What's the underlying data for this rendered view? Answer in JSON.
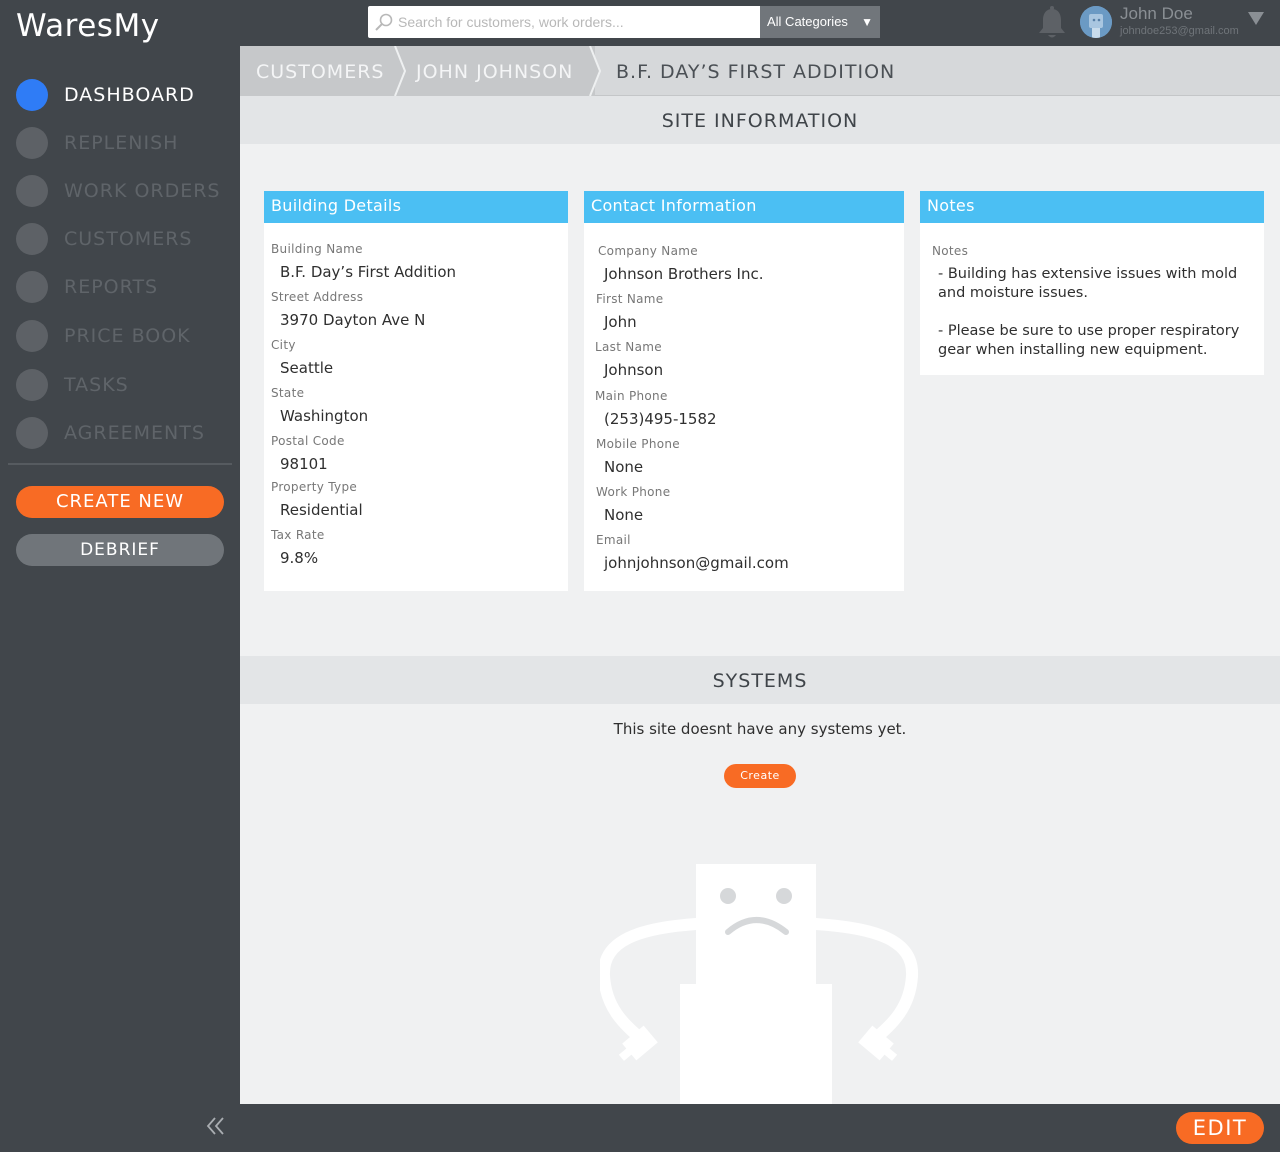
{
  "app": {
    "logo": "WaresMy"
  },
  "search": {
    "placeholder": "Search for customers, work orders...",
    "value": "",
    "category": "All Categories"
  },
  "user": {
    "name": "John Doe",
    "email": "johndoe253@gmail.com"
  },
  "sidebar": {
    "items": [
      {
        "label": "DASHBOARD",
        "active": true
      },
      {
        "label": "REPLENISH",
        "active": false
      },
      {
        "label": "WORK ORDERS",
        "active": false
      },
      {
        "label": "CUSTOMERS",
        "active": false
      },
      {
        "label": "REPORTS",
        "active": false
      },
      {
        "label": "PRICE BOOK",
        "active": false
      },
      {
        "label": "TASKS",
        "active": false
      },
      {
        "label": "AGREEMENTS",
        "active": false
      }
    ],
    "create_new": "CREATE NEW",
    "debrief": "DEBRIEF"
  },
  "breadcrumb": {
    "items": [
      "CUSTOMERS",
      "JOHN JOHNSON",
      "B.F. DAY’S FIRST ADDITION"
    ]
  },
  "site_info": {
    "title": "SITE INFORMATION",
    "building": {
      "title": "Building Details",
      "fields": [
        {
          "label": "Building Name",
          "value": "B.F. Day’s First Addition"
        },
        {
          "label": "Street Address",
          "value": "3970 Dayton Ave N"
        },
        {
          "label": "City",
          "value": "Seattle"
        },
        {
          "label": "State",
          "value": "Washington"
        },
        {
          "label": "Postal Code",
          "value": "98101"
        },
        {
          "label": "Property Type",
          "value": "Residential"
        },
        {
          "label": "Tax Rate",
          "value": "9.8%"
        }
      ]
    },
    "contact": {
      "title": "Contact Information",
      "fields": [
        {
          "label": "Company Name",
          "value": "Johnson Brothers Inc."
        },
        {
          "label": "First Name",
          "value": "John"
        },
        {
          "label": "Last Name",
          "value": "Johnson"
        },
        {
          "label": "Main Phone",
          "value": "(253)495-1582"
        },
        {
          "label": "Mobile Phone",
          "value": "None"
        },
        {
          "label": "Work Phone",
          "value": "None"
        },
        {
          "label": "Email",
          "value": "johnjohnson@gmail.com"
        }
      ]
    },
    "notes": {
      "title": "Notes",
      "label": "Notes",
      "line1": "- Building has extensive issues with mold and moisture issues.",
      "line2": "- Please be sure to use proper respiratory gear when installing new equipment."
    }
  },
  "systems": {
    "title": "SYSTEMS",
    "empty_text": "This site doesnt have any systems yet.",
    "create_label": "Create"
  },
  "footer": {
    "edit_label": "EDIT"
  },
  "colors": {
    "accent_orange": "#f86b24",
    "card_header_blue": "#4bbff3",
    "active_nav": "#2f7cf6",
    "dark_bg": "#41464b"
  }
}
